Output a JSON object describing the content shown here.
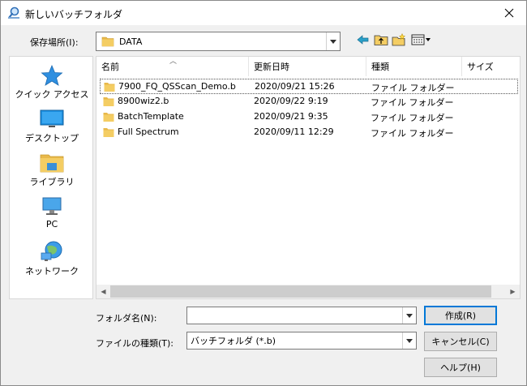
{
  "window": {
    "title": "新しいバッチフォルダ",
    "colors": {
      "accent": "#0078d7",
      "folder": "#e8b84a",
      "selection_border": "#555555"
    }
  },
  "toolbar": {
    "location_label": "保存場所(I):",
    "location_value": "DATA",
    "icons": [
      "back-arrow-icon",
      "up-folder-icon",
      "new-folder-icon",
      "view-menu-icon"
    ]
  },
  "places": [
    {
      "label": "クイック アクセス",
      "icon": "star-icon"
    },
    {
      "label": "デスクトップ",
      "icon": "desktop-icon"
    },
    {
      "label": "ライブラリ",
      "icon": "library-icon"
    },
    {
      "label": "PC",
      "icon": "computer-icon"
    },
    {
      "label": "ネットワーク",
      "icon": "network-icon"
    }
  ],
  "filelist": {
    "columns": [
      "名前",
      "更新日時",
      "種類",
      "サイズ"
    ],
    "rows": [
      {
        "name": "7900_FQ_QSScan_Demo.b",
        "date": "2020/09/21 15:26",
        "type": "ファイル フォルダー",
        "size": "",
        "selected": true
      },
      {
        "name": "8900wiz2.b",
        "date": "2020/09/22 9:19",
        "type": "ファイル フォルダー",
        "size": ""
      },
      {
        "name": "BatchTemplate",
        "date": "2020/09/21 9:35",
        "type": "ファイル フォルダー",
        "size": ""
      },
      {
        "name": "Full Spectrum",
        "date": "2020/09/11 12:29",
        "type": "ファイル フォルダー",
        "size": ""
      }
    ]
  },
  "form": {
    "folder_name_label": "フォルダ名(N):",
    "folder_name_value": "",
    "file_type_label": "ファイルの種類(T):",
    "file_type_value": "バッチフォルダ (*.b)"
  },
  "buttons": {
    "create": "作成(R)",
    "cancel": "キャンセル(C)",
    "help": "ヘルプ(H)"
  }
}
